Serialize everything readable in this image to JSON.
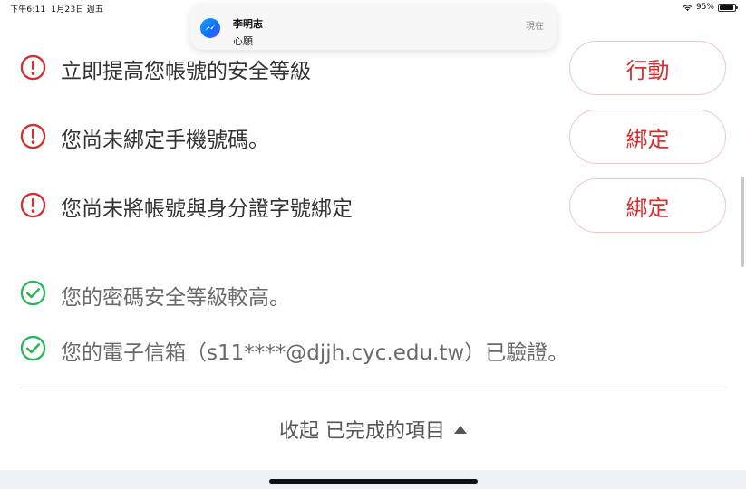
{
  "status_bar": {
    "time": "下午6:11",
    "date": "1月23日 週五",
    "battery": "95%",
    "battery_level": 0.95
  },
  "notification": {
    "app_icon": "messenger-icon",
    "sender": "李明志",
    "message": "心願",
    "time": "現在"
  },
  "warnings": [
    {
      "icon": "exclamation-circle-icon",
      "text": "立即提高您帳號的安全等級",
      "button": "行動"
    },
    {
      "icon": "exclamation-circle-icon",
      "text": "您尚未綁定手機號碼。",
      "button": "綁定"
    },
    {
      "icon": "exclamation-circle-icon",
      "text": "您尚未將帳號與身分證字號綁定",
      "button": "綁定"
    }
  ],
  "completed": [
    {
      "icon": "check-circle-icon",
      "text": "您的密碼安全等級較高。"
    },
    {
      "icon": "check-circle-icon",
      "text": "您的電子信箱（s11****@djjh.cyc.edu.tw）已驗證。"
    }
  ],
  "collapse": {
    "label": "收起 已完成的項目",
    "icon": "triangle-up-icon"
  },
  "colors": {
    "warning": "#d32f2f",
    "success": "#2bb55a",
    "button_border": "#f0c8c8"
  }
}
